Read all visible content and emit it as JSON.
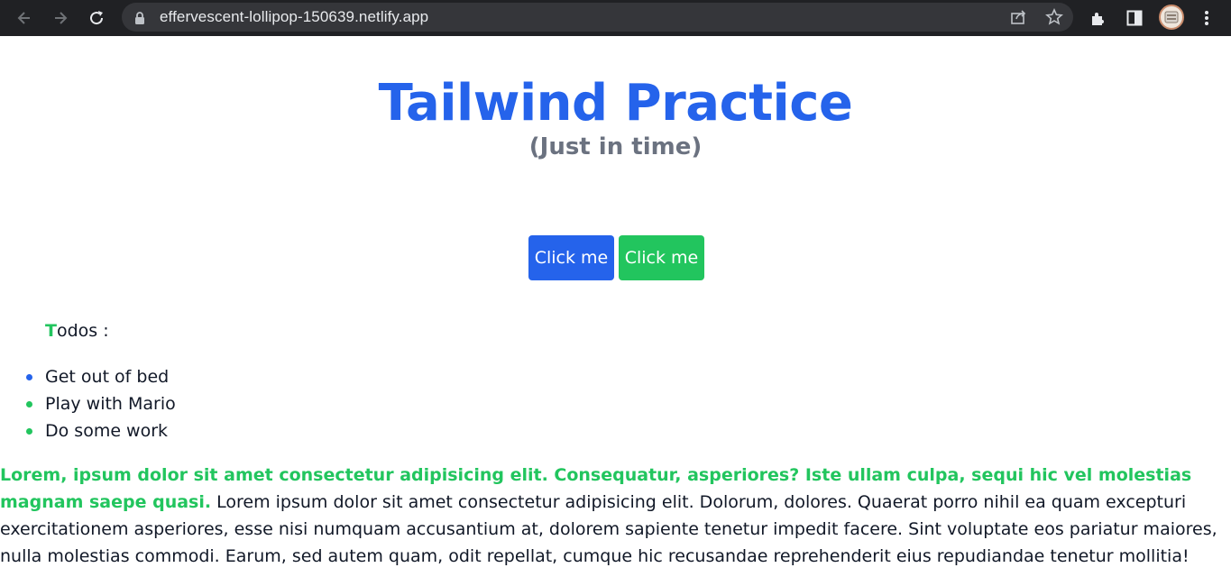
{
  "browser": {
    "url": "effervescent-lollipop-150639.netlify.app",
    "icons": [
      "back-arrow-icon",
      "forward-arrow-icon",
      "reload-icon",
      "lock-icon",
      "share-icon",
      "star-icon",
      "extensions-icon",
      "side-panel-icon",
      "profile-avatar",
      "kebab-menu-icon"
    ]
  },
  "header": {
    "title": "Tailwind Practice",
    "subtitle": "(Just in time)"
  },
  "buttons": {
    "primary_label": "Click me",
    "secondary_label": "Click me"
  },
  "todos": {
    "heading_first_letter": "T",
    "heading_rest": "odos :",
    "items": [
      {
        "label": "Get out of bed",
        "bullet_color": "#2563eb"
      },
      {
        "label": "Play with Mario",
        "bullet_color": "#22c55e"
      },
      {
        "label": "Do some work",
        "bullet_color": "#22c55e"
      }
    ]
  },
  "paragraph": {
    "highlight": "Lorem, ipsum dolor sit amet consectetur adipisicing elit. Consequatur, asperiores? Iste ullam culpa, sequi hic vel molestias magnam saepe quasi.",
    "body": "Lorem ipsum dolor sit amet consectetur adipisicing elit. Dolorum, dolores. Quaerat porro nihil ea quam excepturi exercitationem asperiores, esse nisi numquam accusantium at, dolorem sapiente tenetur impedit facere. Sint voluptate eos pariatur maiores, nulla molestias commodi. Earum, sed autem quam, odit repellat, cumque hic recusandae reprehenderit eius repudiandae tenetur mollitia!"
  },
  "colors": {
    "blue": "#2563eb",
    "green": "#22c55e",
    "gray": "#6b7280",
    "chrome_bg": "#202124",
    "omnibox_bg": "#35363a"
  }
}
